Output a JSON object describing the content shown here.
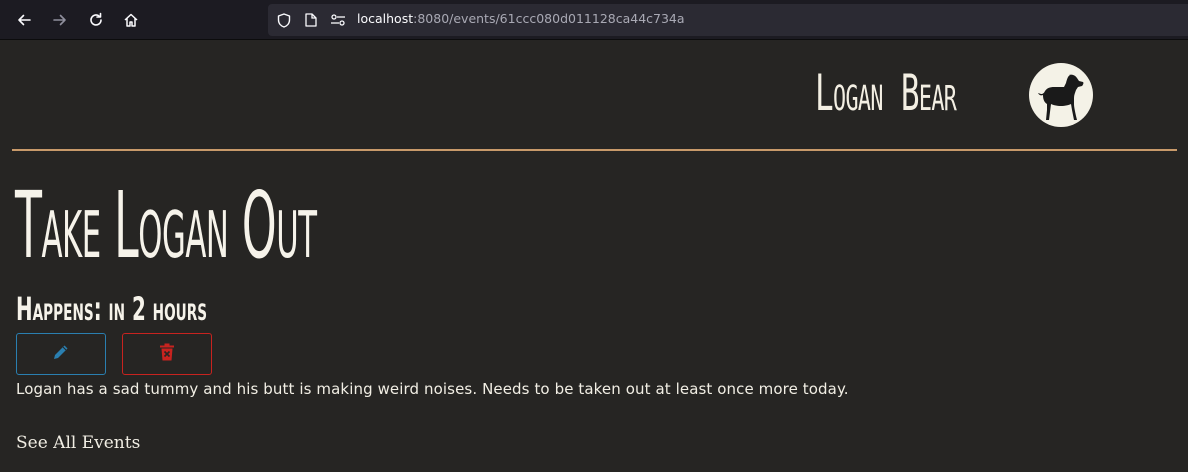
{
  "browser": {
    "url_host": "localhost",
    "url_path": ":8080/events/61ccc080d011128ca44c734a"
  },
  "header": {
    "site_title": "Logan Bear",
    "logo_icon": "dog-silhouette-icon"
  },
  "event": {
    "title": "Take Logan Out",
    "happens": "Happens: in 2 hours",
    "description": "Logan has a sad tummy and his butt is making weird noises. Needs to be taken out at least once more today."
  },
  "actions": {
    "edit_icon": "pencil-icon",
    "delete_icon": "trash-icon"
  },
  "links": {
    "see_all": "See All Events"
  },
  "colors": {
    "background": "#262523",
    "divider": "#c89a6a",
    "edit": "#2a7fb0",
    "delete": "#c8231f",
    "text": "#f1eee4"
  }
}
